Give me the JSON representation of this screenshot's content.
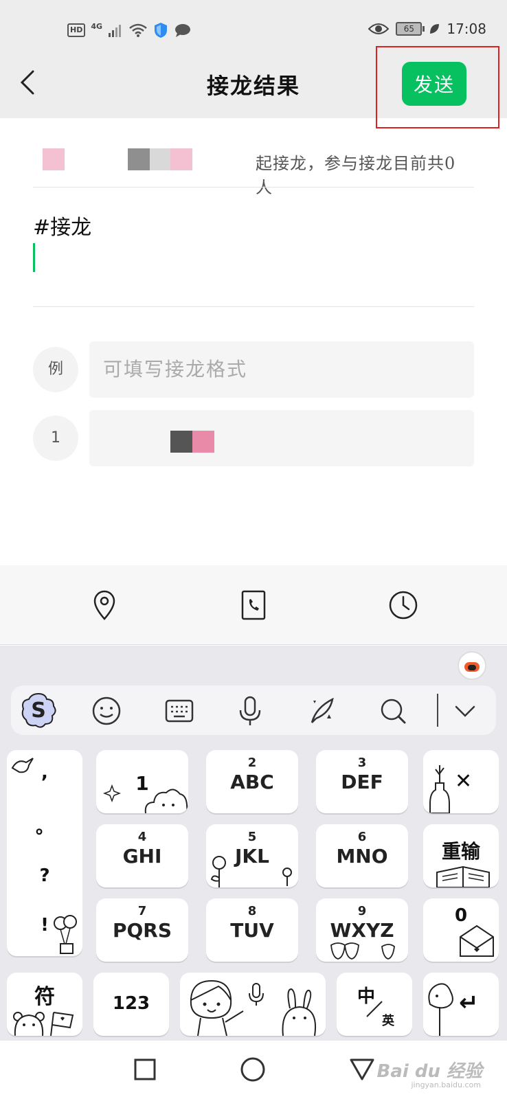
{
  "status_bar": {
    "hd": "HD",
    "network": "4G",
    "battery": "65",
    "time": "17:08"
  },
  "header": {
    "title": "接龙结果",
    "send_label": "发送"
  },
  "content": {
    "info_text": "起接龙，参与接龙目前共0人",
    "topic": "#接龙",
    "example_badge": "例",
    "example_placeholder": "可填写接龙格式",
    "row1_number": "1"
  },
  "toolbar": {
    "items": [
      {
        "icon": "location-icon"
      },
      {
        "icon": "phone-icon"
      },
      {
        "icon": "clock-icon"
      }
    ]
  },
  "keyboard": {
    "punct": [
      ",",
      "。",
      "?",
      "!"
    ],
    "rows": [
      [
        {
          "num": "",
          "letters": "1"
        },
        {
          "num": "2",
          "letters": "ABC"
        },
        {
          "num": "3",
          "letters": "DEF"
        }
      ],
      [
        {
          "num": "4",
          "letters": "GHI"
        },
        {
          "num": "5",
          "letters": "JKL"
        },
        {
          "num": "6",
          "letters": "MNO"
        }
      ],
      [
        {
          "num": "7",
          "letters": "PQRS"
        },
        {
          "num": "8",
          "letters": "TUV"
        },
        {
          "num": "9",
          "letters": "WXYZ"
        }
      ]
    ],
    "delete_label": "✕",
    "retype_label": "重输",
    "zero_label": "0",
    "symbol_label": "符",
    "num_label": "123",
    "lang_top": "中",
    "lang_bottom": "英",
    "enter_label": "↵"
  },
  "watermark": {
    "brand": "Bai du 经验",
    "url": "jingyan.baidu.com"
  },
  "colors": {
    "accent": "#07c160",
    "highlight_box": "#e02020"
  }
}
